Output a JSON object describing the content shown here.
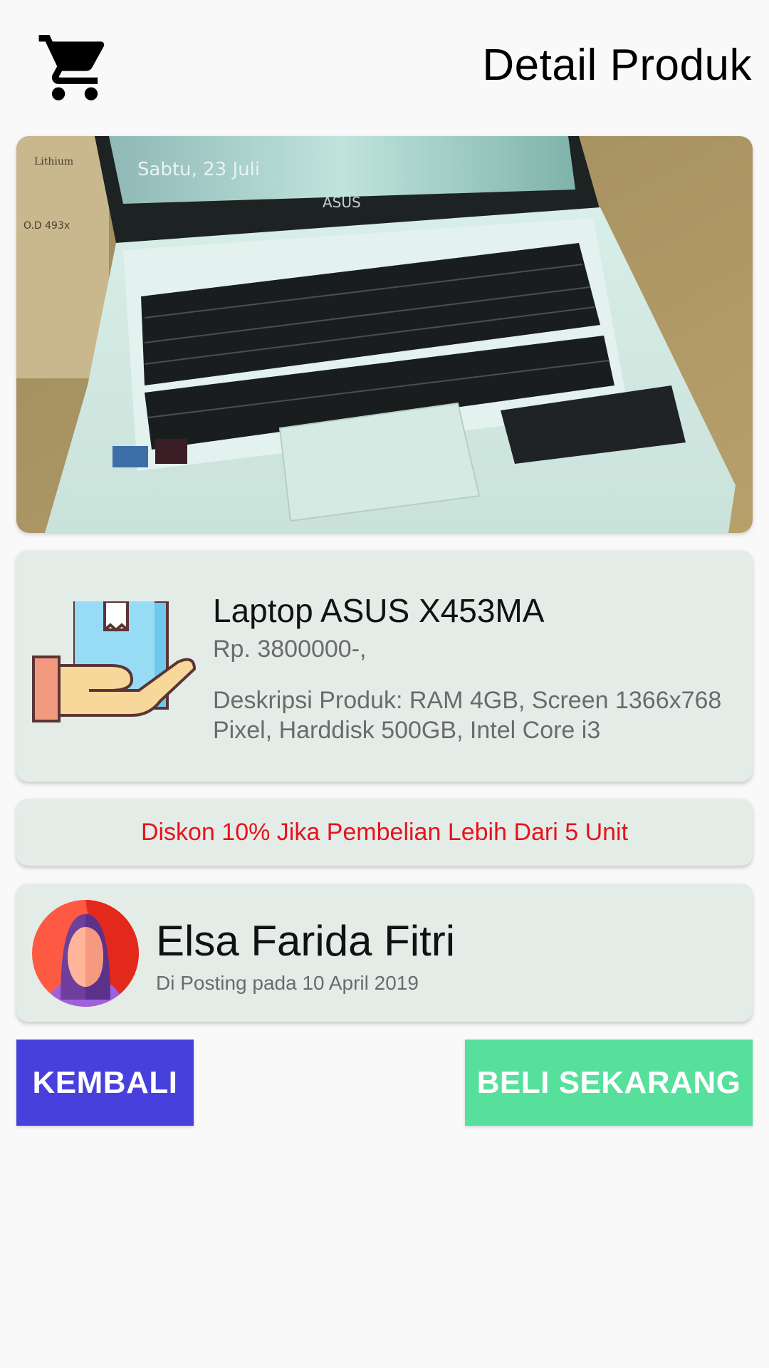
{
  "header": {
    "title": "Detail Produk",
    "cart_icon": "shopping-cart-icon"
  },
  "product": {
    "image_icon": "laptop-photo",
    "screen_text": "Sabtu, 23 Juli",
    "brand_on_image": "ASUS",
    "name": "Laptop ASUS X453MA",
    "price": "Rp. 3800000-,",
    "description": "Deskripsi Produk: RAM 4GB, Screen 1366x768 Pixel, Harddisk 500GB, Intel Core i3",
    "icon": "hand-holding-box-icon"
  },
  "promo": {
    "text": "Diskon 10% Jika Pembelian Lebih Dari 5 Unit",
    "color": "#e8121b"
  },
  "poster": {
    "name": "Elsa Farida Fitri",
    "posted": "Di Posting pada 10 April 2019",
    "avatar_icon": "hijab-woman-avatar-icon"
  },
  "buttons": {
    "back_label": "KEMBALI",
    "buy_label": "BELI SEKARANG",
    "back_color": "#4840dc",
    "buy_color": "#56e09c"
  }
}
